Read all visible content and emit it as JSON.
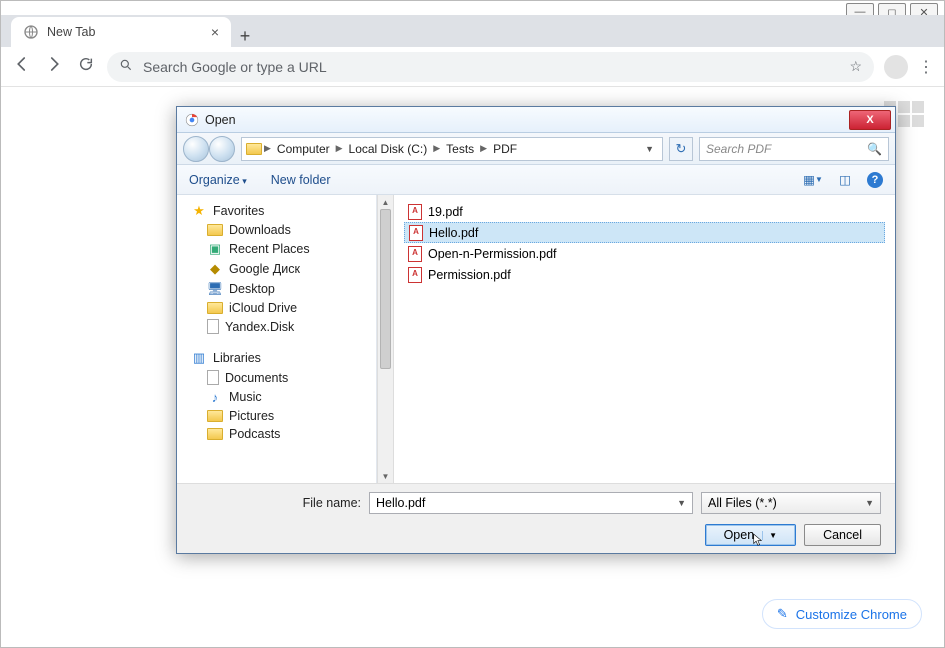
{
  "browser": {
    "tab_title": "New Tab",
    "omnibox_placeholder": "Search Google or type a URL",
    "customize_label": "Customize Chrome"
  },
  "dialog": {
    "title": "Open",
    "breadcrumb": [
      "Computer",
      "Local Disk (C:)",
      "Tests",
      "PDF"
    ],
    "search_placeholder": "Search PDF",
    "toolbar": {
      "organize": "Organize",
      "new_folder": "New folder"
    },
    "tree": {
      "favorites": "Favorites",
      "fav_items": [
        "Downloads",
        "Recent Places",
        "Google Диск",
        "Desktop",
        "iCloud Drive",
        "Yandex.Disk"
      ],
      "libraries": "Libraries",
      "lib_items": [
        "Documents",
        "Music",
        "Pictures",
        "Podcasts"
      ]
    },
    "files": [
      "19.pdf",
      "Hello.pdf",
      "Open-n-Permission.pdf",
      "Permission.pdf"
    ],
    "selected_file_index": 1,
    "filename_label": "File name:",
    "filename_value": "Hello.pdf",
    "filter_value": "All Files (*.*)",
    "open_btn": "Open",
    "cancel_btn": "Cancel"
  }
}
